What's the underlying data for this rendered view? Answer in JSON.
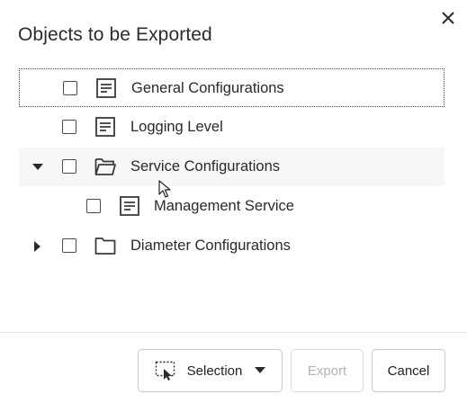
{
  "dialog": {
    "title": "Objects to be Exported"
  },
  "tree": [
    {
      "label": "General Configurations",
      "type": "document"
    },
    {
      "label": "Logging Level",
      "type": "document"
    },
    {
      "label": "Service Configurations",
      "type": "folder",
      "expanded": true
    },
    {
      "label": "Management Service",
      "type": "document"
    },
    {
      "label": "Diameter Configurations",
      "type": "folder",
      "expanded": false
    }
  ],
  "footer": {
    "selection_label": "Selection",
    "export_label": "Export",
    "cancel_label": "Cancel"
  },
  "icons": {
    "close": "close-icon",
    "document": "document-icon",
    "folder": "folder-icon",
    "selection": "marquee-select-icon",
    "caret": "caret-down-icon",
    "pointer": "mouse-pointer-icon"
  }
}
